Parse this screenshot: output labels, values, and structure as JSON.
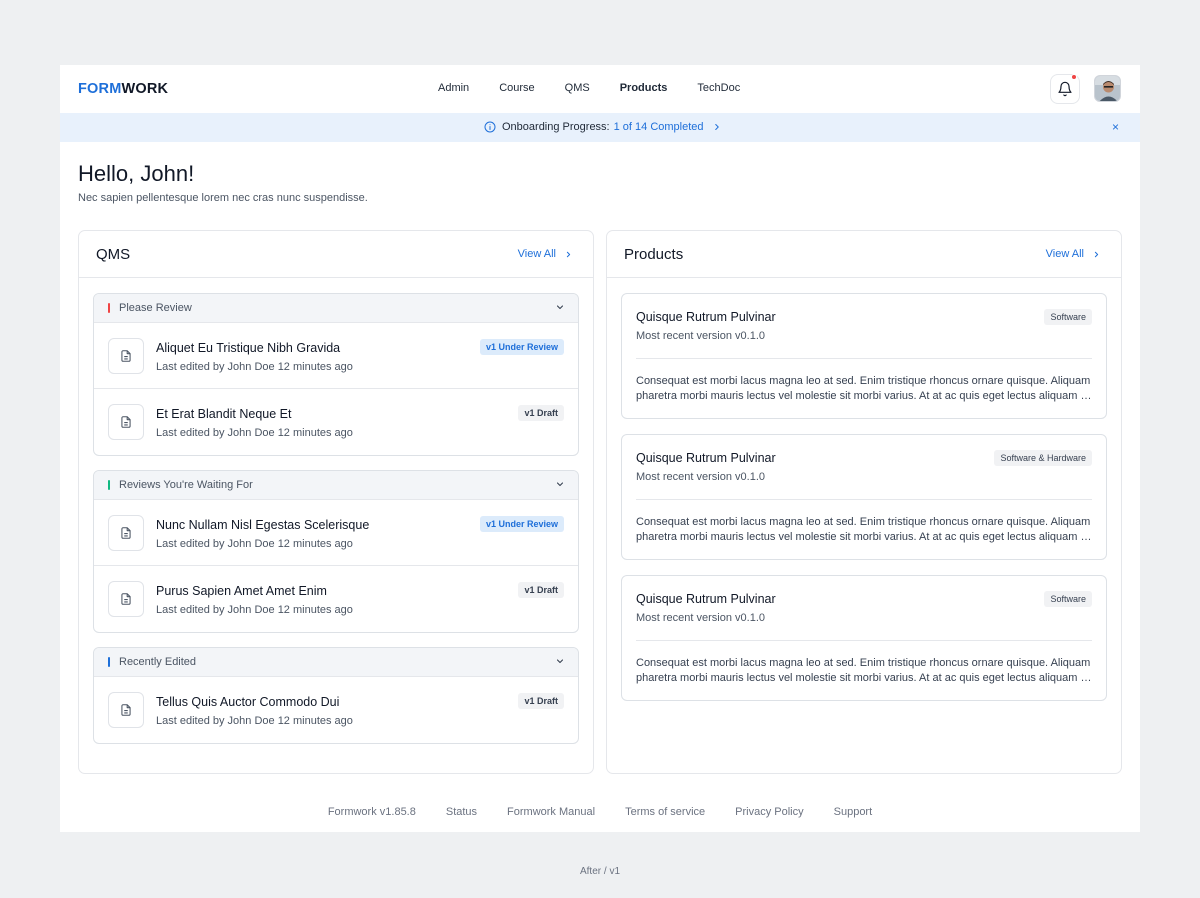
{
  "brand": {
    "part1": "FORM",
    "part2": "WORK"
  },
  "nav": [
    "Admin",
    "Course",
    "QMS",
    "Products",
    "TechDoc"
  ],
  "nav_active": "Products",
  "banner": {
    "label": "Onboarding Progress:",
    "progress": "1 of 14 Completed",
    "close": "×"
  },
  "greeting": {
    "title": "Hello, John!",
    "subtitle": "Nec sapien pellentesque lorem nec cras nunc suspendisse."
  },
  "qms": {
    "title": "QMS",
    "view_all": "View All",
    "groups": [
      {
        "label": "Please Review",
        "color": "#ef4444",
        "items": [
          {
            "title": "Aliquet Eu Tristique Nibh Gravida",
            "meta": "Last edited by John Doe 12 minutes ago",
            "badge": "v1 Under Review",
            "badge_type": "review"
          },
          {
            "title": "Et Erat Blandit Neque Et",
            "meta": "Last edited by John Doe 12 minutes ago",
            "badge": "v1 Draft",
            "badge_type": "draft"
          }
        ]
      },
      {
        "label": "Reviews You're Waiting For",
        "color": "#10b981",
        "items": [
          {
            "title": "Nunc Nullam Nisl Egestas Scelerisque",
            "meta": "Last edited by John Doe 12 minutes ago",
            "badge": "v1 Under Review",
            "badge_type": "review"
          },
          {
            "title": "Purus Sapien Amet Amet Enim",
            "meta": "Last edited by John Doe 12 minutes ago",
            "badge": "v1 Draft",
            "badge_type": "draft"
          }
        ]
      },
      {
        "label": "Recently Edited",
        "color": "#1e6fd9",
        "items": [
          {
            "title": "Tellus Quis Auctor Commodo Dui",
            "meta": "Last edited by John Doe 12 minutes ago",
            "badge": "v1 Draft",
            "badge_type": "draft"
          }
        ]
      }
    ]
  },
  "products": {
    "title": "Products",
    "view_all": "View All",
    "items": [
      {
        "title": "Quisque Rutrum Pulvinar",
        "version": "Most recent version v0.1.0",
        "badge": "Software",
        "desc_line1": "Consequat est morbi lacus magna leo at sed. Enim tristique rhoncus ornare quisque. Aliquam",
        "desc_line2": "pharetra morbi mauris lectus vel molestie sit morbi varius. At at ac quis eget lectus aliquam aliquam"
      },
      {
        "title": "Quisque Rutrum Pulvinar",
        "version": "Most recent version v0.1.0",
        "badge": "Software & Hardware",
        "desc_line1": "Consequat est morbi lacus magna leo at sed. Enim tristique rhoncus ornare quisque. Aliquam",
        "desc_line2": "pharetra morbi mauris lectus vel molestie sit morbi varius. At at ac quis eget lectus aliquam aliquam"
      },
      {
        "title": "Quisque Rutrum Pulvinar",
        "version": "Most recent version v0.1.0",
        "badge": "Software",
        "desc_line1": "Consequat est morbi lacus magna leo at sed. Enim tristique rhoncus ornare quisque. Aliquam",
        "desc_line2": "pharetra morbi mauris lectus vel molestie sit morbi varius. At at ac quis eget lectus aliquam aliquam"
      }
    ]
  },
  "footer": [
    "Formwork v1.85.8",
    "Status",
    "Formwork Manual",
    "Terms of service",
    "Privacy Policy",
    "Support"
  ],
  "caption": "After / v1",
  "colors": {
    "accent": "#1e6fd9",
    "notification": "#ef4444",
    "banner_bg": "#e8f1fc"
  }
}
